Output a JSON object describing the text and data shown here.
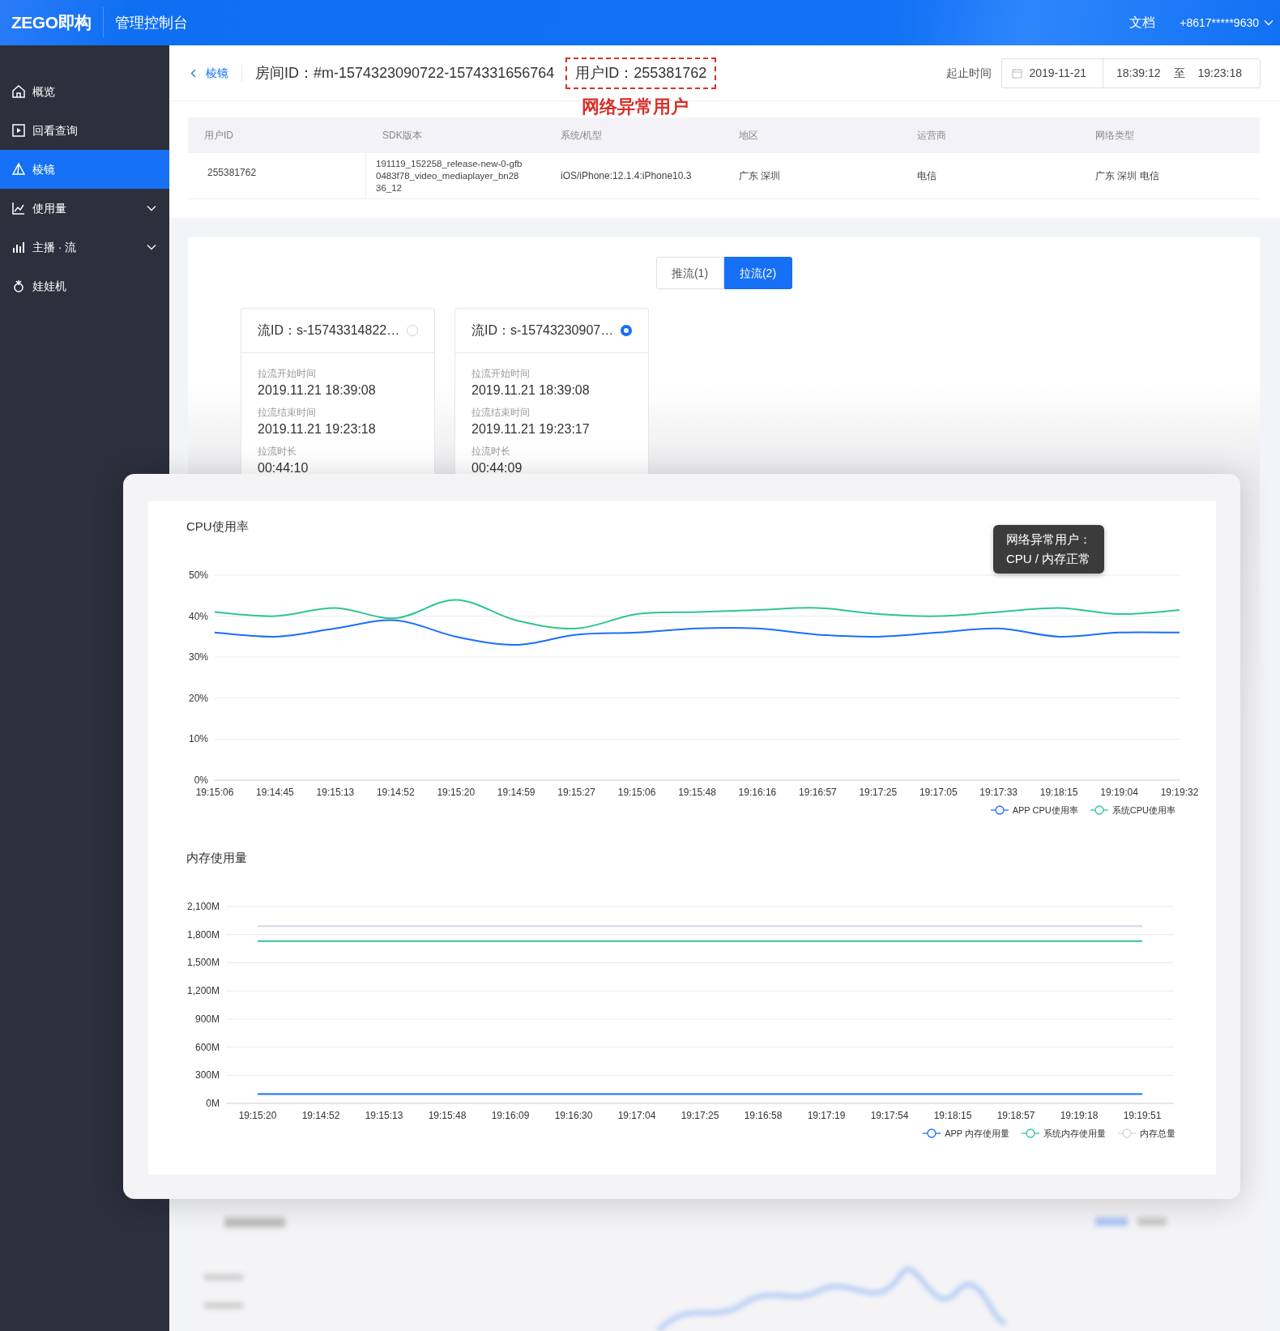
{
  "header": {
    "logo": "ZEGO即构",
    "title": "管理控制台",
    "links": [
      "文档"
    ],
    "account": "+8617*****9630"
  },
  "sidebar": {
    "items": [
      {
        "label": "概览",
        "kind": "link",
        "selected": false
      },
      {
        "label": "回看查询",
        "kind": "link",
        "selected": false
      },
      {
        "label": "棱镜",
        "kind": "link",
        "selected": true
      },
      {
        "label": "使用量",
        "kind": "group",
        "selected": false
      },
      {
        "label": "主播 · 流",
        "kind": "group",
        "selected": false
      },
      {
        "label": "娃娃机",
        "kind": "link",
        "selected": false
      }
    ]
  },
  "breadcrumb": {
    "back_link": "棱镜",
    "room_id": "房间ID：#m-1574323090722-1574331656764",
    "user_id": {
      "text": "用户ID：255381762",
      "highlighted": true
    },
    "annotation": "网络异常用户"
  },
  "time_range": {
    "label": "起止时间",
    "date": "2019-11-21",
    "start": "18:39:12",
    "separator": "至",
    "end": "19:23:18"
  },
  "table": {
    "columns": [
      "用户ID",
      "SDK版本",
      "系统/机型",
      "地区",
      "运营商",
      "网络类型"
    ],
    "rows": [
      [
        "255381762",
        "191119_152258_release-new-0-gfb0483f78_video_mediaplayer_bn2836_12",
        "iOS/iPhone:12.1.4:iPhone10.3",
        "广东 深圳",
        "电信",
        "广东 深圳 电信"
      ]
    ]
  },
  "stream_tabs": [
    {
      "label": "推流(1)",
      "selected": false
    },
    {
      "label": "拉流(2)",
      "selected": true
    }
  ],
  "streams": [
    {
      "title": "流ID：s-15743314822…",
      "selected": false,
      "fields": [
        {
          "label": "拉流开始时间",
          "value": "2019.11.21 18:39:08"
        },
        {
          "label": "拉流结束时间",
          "value": "2019.11.21 19:23:18"
        },
        {
          "label": "拉流时长",
          "value": "00:44:10"
        }
      ]
    },
    {
      "title": "流ID：s-15743230907…",
      "selected": true,
      "fields": [
        {
          "label": "拉流开始时间",
          "value": "2019.11.21 18:39:08"
        },
        {
          "label": "拉流结束时间",
          "value": "2019.11.21 19:23:17"
        },
        {
          "label": "拉流时长",
          "value": "00:44:09"
        }
      ]
    }
  ],
  "overlay": {
    "charts": [
      {
        "chart_data": {
          "type": "line",
          "title": "CPU使用率",
          "categories": [
            "19:15:06",
            "19:14:45",
            "19:15:13",
            "19:14:52",
            "19:15:20",
            "19:14:59",
            "19:15:27",
            "19:15:06",
            "19:15:48",
            "19:16:16",
            "19:16:57",
            "19:17:25",
            "19:17:05",
            "19:17:33",
            "19:18:15",
            "19:19:04",
            "19:19:32"
          ],
          "series": [
            {
              "name": "APP CPU使用率",
              "color": "#1a6dff",
              "values": [
                36,
                35,
                37,
                39,
                35,
                33,
                35.5,
                36,
                37,
                37,
                35.5,
                35,
                36,
                37,
                35,
                36,
                36
              ]
            },
            {
              "name": "系统CPU使用率",
              "color": "#2ec68d",
              "values": [
                41,
                40,
                42,
                39.5,
                44,
                39,
                37,
                40.5,
                41,
                41.5,
                42,
                40.5,
                40,
                41,
                42,
                40.5,
                41.5
              ]
            }
          ],
          "ylim": [
            0,
            50
          ],
          "grid": true,
          "legend": "bottom-right",
          "yticks": [
            {
              "value": 0,
              "label": "0%"
            },
            {
              "value": 10,
              "label": "10%"
            },
            {
              "value": 20,
              "label": "20%"
            },
            {
              "value": 30,
              "label": "30%"
            },
            {
              "value": 40,
              "label": "40%"
            },
            {
              "value": 50,
              "label": "50%"
            }
          ]
        },
        "callout": [
          "网络异常用户：",
          "CPU / 内存正常"
        ]
      },
      {
        "chart_data": {
          "type": "line",
          "title": "内存使用量",
          "categories": [
            "19:15:20",
            "19:14:52",
            "19:15:13",
            "19:15:48",
            "19:16:09",
            "19:16:30",
            "19:17:04",
            "19:17:25",
            "19:16:58",
            "19:17:19",
            "19:17:54",
            "19:18:15",
            "19:18:57",
            "19:19:18",
            "19:19:51"
          ],
          "series": [
            {
              "name": "APP 内存使用量",
              "color": "#1a6dff",
              "values": [
                100,
                100,
                100,
                100,
                100,
                100,
                100,
                100,
                100,
                100,
                100,
                100,
                100,
                100,
                100
              ]
            },
            {
              "name": "系统内存使用量",
              "color": "#2ec68d",
              "values": [
                1730,
                1730,
                1730,
                1730,
                1730,
                1730,
                1730,
                1730,
                1730,
                1730,
                1730,
                1730,
                1730,
                1730,
                1730
              ]
            },
            {
              "name": "内存总量",
              "color": "#d4d4e0",
              "values": [
                1890,
                1890,
                1890,
                1890,
                1890,
                1890,
                1890,
                1890,
                1890,
                1890,
                1890,
                1890,
                1890,
                1890,
                1890
              ]
            }
          ],
          "ylim": [
            0,
            2100
          ],
          "grid": true,
          "legend": "bottom-right",
          "yticks": [
            {
              "value": 0,
              "label": "0M"
            },
            {
              "value": 300,
              "label": "300M"
            },
            {
              "value": 600,
              "label": "600M"
            },
            {
              "value": 900,
              "label": "900M"
            },
            {
              "value": 1200,
              "label": "1,200M"
            },
            {
              "value": 1500,
              "label": "1,500M"
            },
            {
              "value": 1800,
              "label": "1,800M"
            },
            {
              "value": 2100,
              "label": "2,100M"
            }
          ]
        }
      }
    ]
  }
}
